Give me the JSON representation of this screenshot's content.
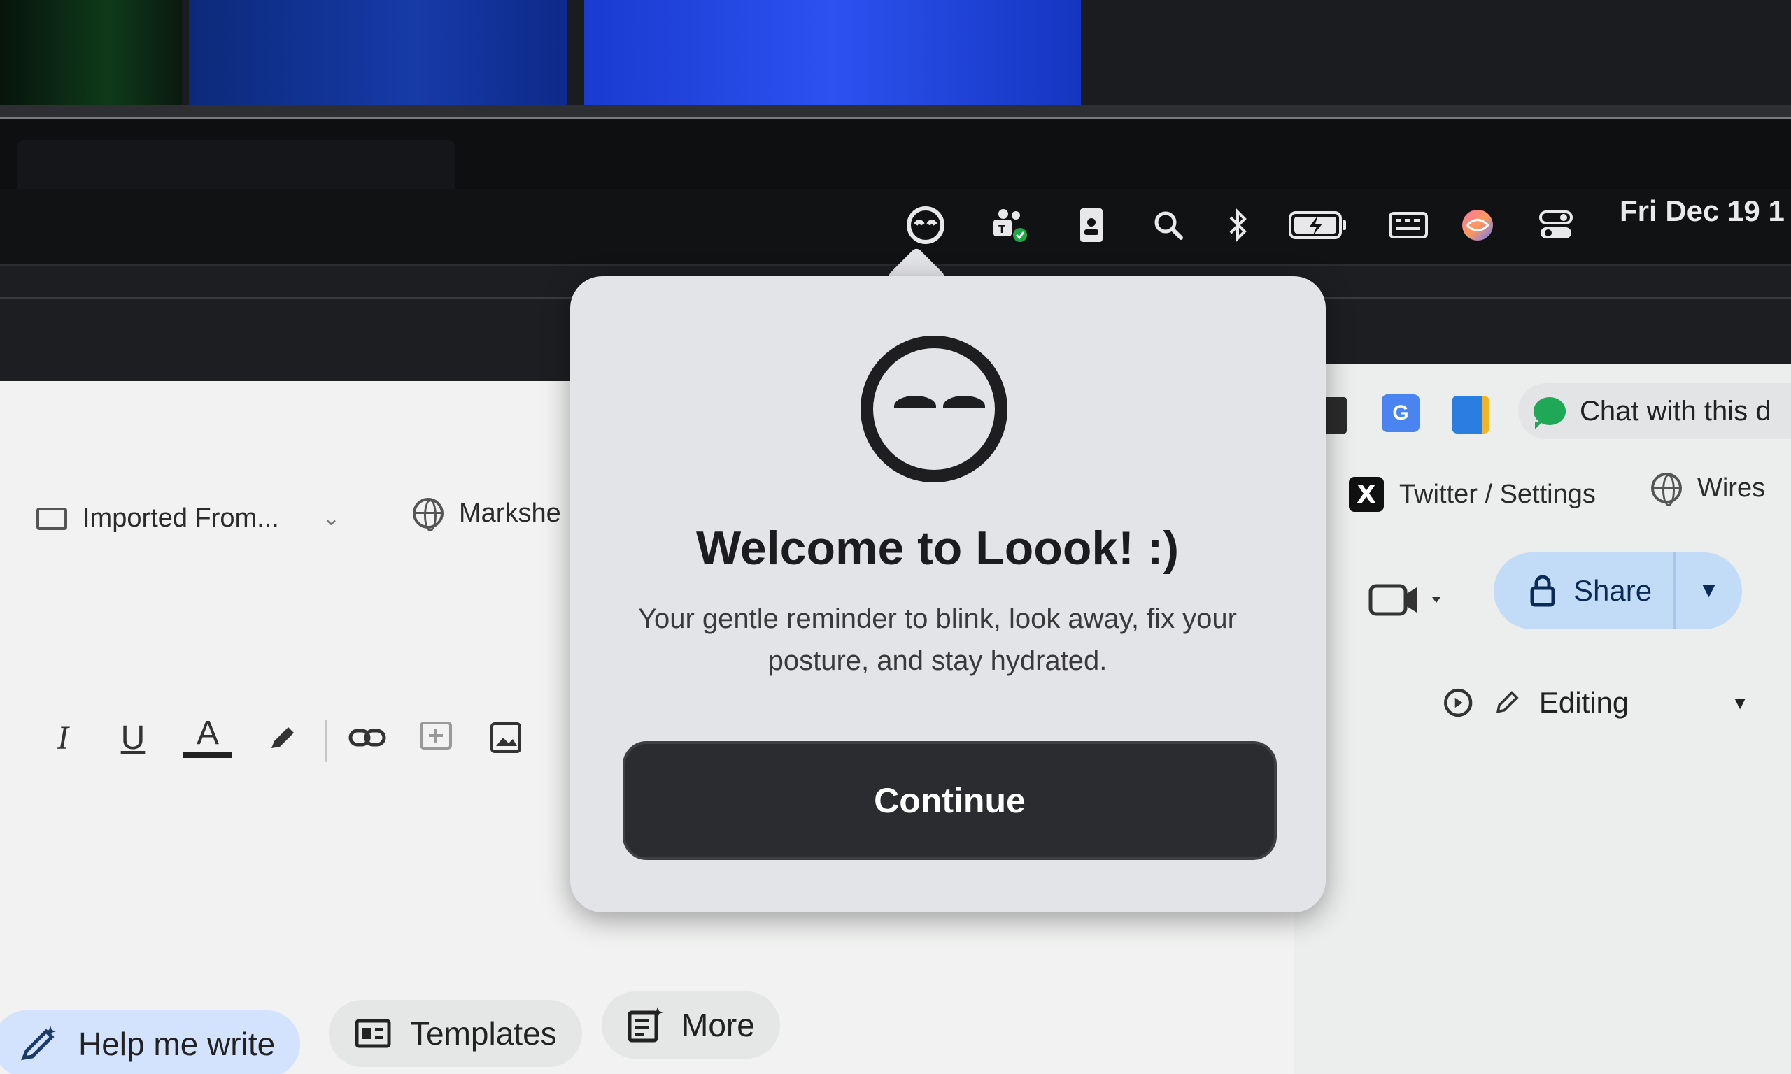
{
  "menubar": {
    "clock": "Fri Dec 19 1",
    "icons": [
      "loook-icon",
      "teams-icon",
      "badge-icon",
      "search-icon",
      "bluetooth-icon",
      "battery-icon",
      "keyboard-icon",
      "siri-icon",
      "control-center-icon"
    ]
  },
  "bookmarks": {
    "imported": "Imported From...",
    "markshe": "Markshe",
    "twitter": "Twitter / Settings",
    "wires": "Wires"
  },
  "extensions": {
    "chat": "Chat with this d"
  },
  "toolbar": {
    "share_label": "Share",
    "editing_label": "Editing"
  },
  "chips": {
    "help_me_write": "Help me write",
    "templates": "Templates",
    "more": "More"
  },
  "popover": {
    "title": "Welcome to Loook! :)",
    "body": "Your gentle reminder to blink, look away, fix your posture, and stay hydrated.",
    "continue_label": "Continue"
  }
}
